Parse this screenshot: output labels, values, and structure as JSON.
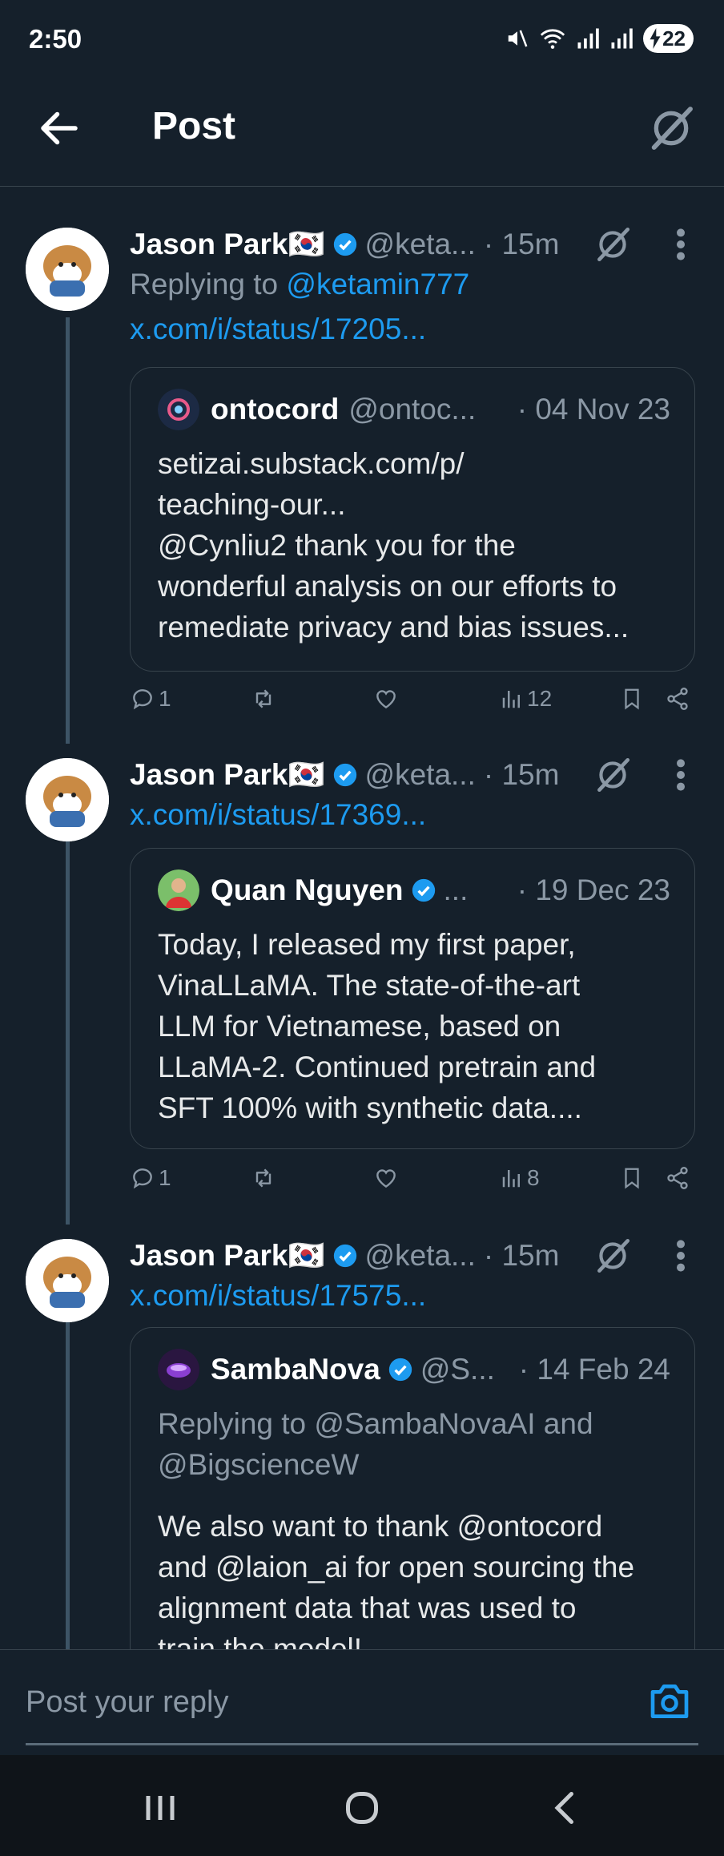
{
  "status_bar": {
    "time": "2:50",
    "battery": "22"
  },
  "header": {
    "title": "Post"
  },
  "posts": [
    {
      "author": "Jason Park🇰🇷",
      "handle": "@keta...",
      "time": "· 15m",
      "replying_prefix": "Replying to ",
      "replying_to": "@ketamin777",
      "link": "x.com/i/status/17205...",
      "quote": {
        "author": "ontocord",
        "handle": "@ontoc...",
        "date": "· 04 Nov 23",
        "text_lines": [
          "setizai.substack.com/p/",
          "teaching-our...",
          "@Cynliu2 thank you for the",
          "wonderful analysis on our efforts to",
          "remediate privacy and bias issues..."
        ]
      },
      "stats": {
        "replies": "1",
        "views": "12"
      }
    },
    {
      "author": "Jason Park🇰🇷",
      "handle": "@keta...",
      "time": "· 15m",
      "link": "x.com/i/status/17369...",
      "quote": {
        "author": "Quan Nguyen",
        "handle": "...",
        "date": "· 19 Dec 23",
        "text_lines": [
          "Today, I released my first paper,",
          "VinaLLaMA. The state-of-the-art",
          "LLM for Vietnamese, based on",
          "LLaMA-2. Continued pretrain and",
          "SFT 100% with synthetic data...."
        ]
      },
      "stats": {
        "replies": "1",
        "views": "8"
      }
    },
    {
      "author": "Jason Park🇰🇷",
      "handle": "@keta...",
      "time": "· 15m",
      "link": "x.com/i/status/17575...",
      "quote": {
        "author": "SambaNova",
        "handle": "@S...",
        "date": "· 14 Feb 24",
        "replying_lines": [
          "Replying to @SambaNovaAI and",
          "@BigscienceW"
        ],
        "text_lines": [
          "We also want to thank @ontocord",
          "and @laion_ai for open sourcing the",
          "alignment data that was used to",
          "train the model!"
        ]
      }
    }
  ],
  "reply_bar": {
    "placeholder": "Post your reply"
  },
  "colors": {
    "background": "#15202b",
    "accent": "#1d9bf0",
    "muted": "#8b98a5",
    "border": "#38444d"
  }
}
